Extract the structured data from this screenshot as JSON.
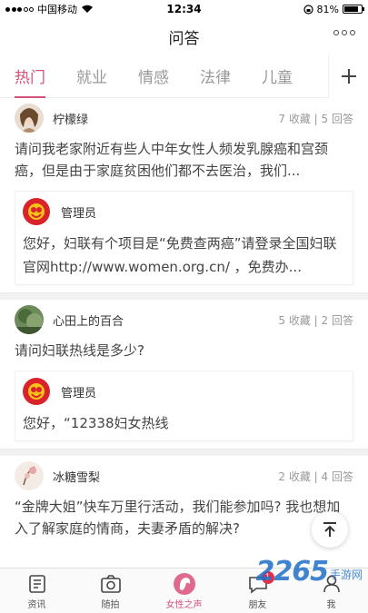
{
  "status_bar": {
    "carrier": "中国移动",
    "time": "12:34",
    "battery": "81%",
    "battery_level": 0.81
  },
  "header": {
    "title": "问答"
  },
  "tabs": [
    {
      "label": "热门",
      "active": true
    },
    {
      "label": "就业",
      "active": false
    },
    {
      "label": "情感",
      "active": false
    },
    {
      "label": "法律",
      "active": false
    },
    {
      "label": "儿童",
      "active": false
    }
  ],
  "questions": [
    {
      "user": "柠檬绿",
      "stats": "7 收藏 | 5 回答",
      "text": "请问我老家附近有些人中年女性人频发乳腺癌和宫颈癌，但是由于家庭贫困他们都不去医治，我们...",
      "answer": {
        "user": "管理员",
        "text": "您好，妇联有个项目是“免费查两癌”请登录全国妇联官网http://www.women.org.cn/ ，免费办..."
      }
    },
    {
      "user": "心田上的百合",
      "stats": "5 收藏 | 2 回答",
      "text": "请问妇联热线是多少?",
      "answer": {
        "user": "管理员",
        "text": "您好，“12338妇女热线"
      }
    },
    {
      "user": "冰糖雪梨",
      "stats": "2 收藏 | 4 回答",
      "text": "“金牌大姐”快车万里行活动，我们能参加吗? 我也想加入了解家庭的情商，夫妻矛盾的解决?",
      "answer": null
    }
  ],
  "bottom_nav": [
    {
      "label": "资讯",
      "icon": "news-icon",
      "active": false
    },
    {
      "label": "随拍",
      "icon": "camera-icon",
      "active": false
    },
    {
      "label": "女性之声",
      "icon": "female-voice-icon",
      "active": true
    },
    {
      "label": "朋友",
      "icon": "friends-icon",
      "active": false,
      "badge": "1"
    },
    {
      "label": "我",
      "icon": "profile-icon",
      "active": false
    }
  ],
  "watermark": {
    "number": "2265",
    "text": "手游网"
  },
  "colors": {
    "accent": "#d4537a",
    "badge": "#e0304a",
    "logo": "#d9222a"
  }
}
